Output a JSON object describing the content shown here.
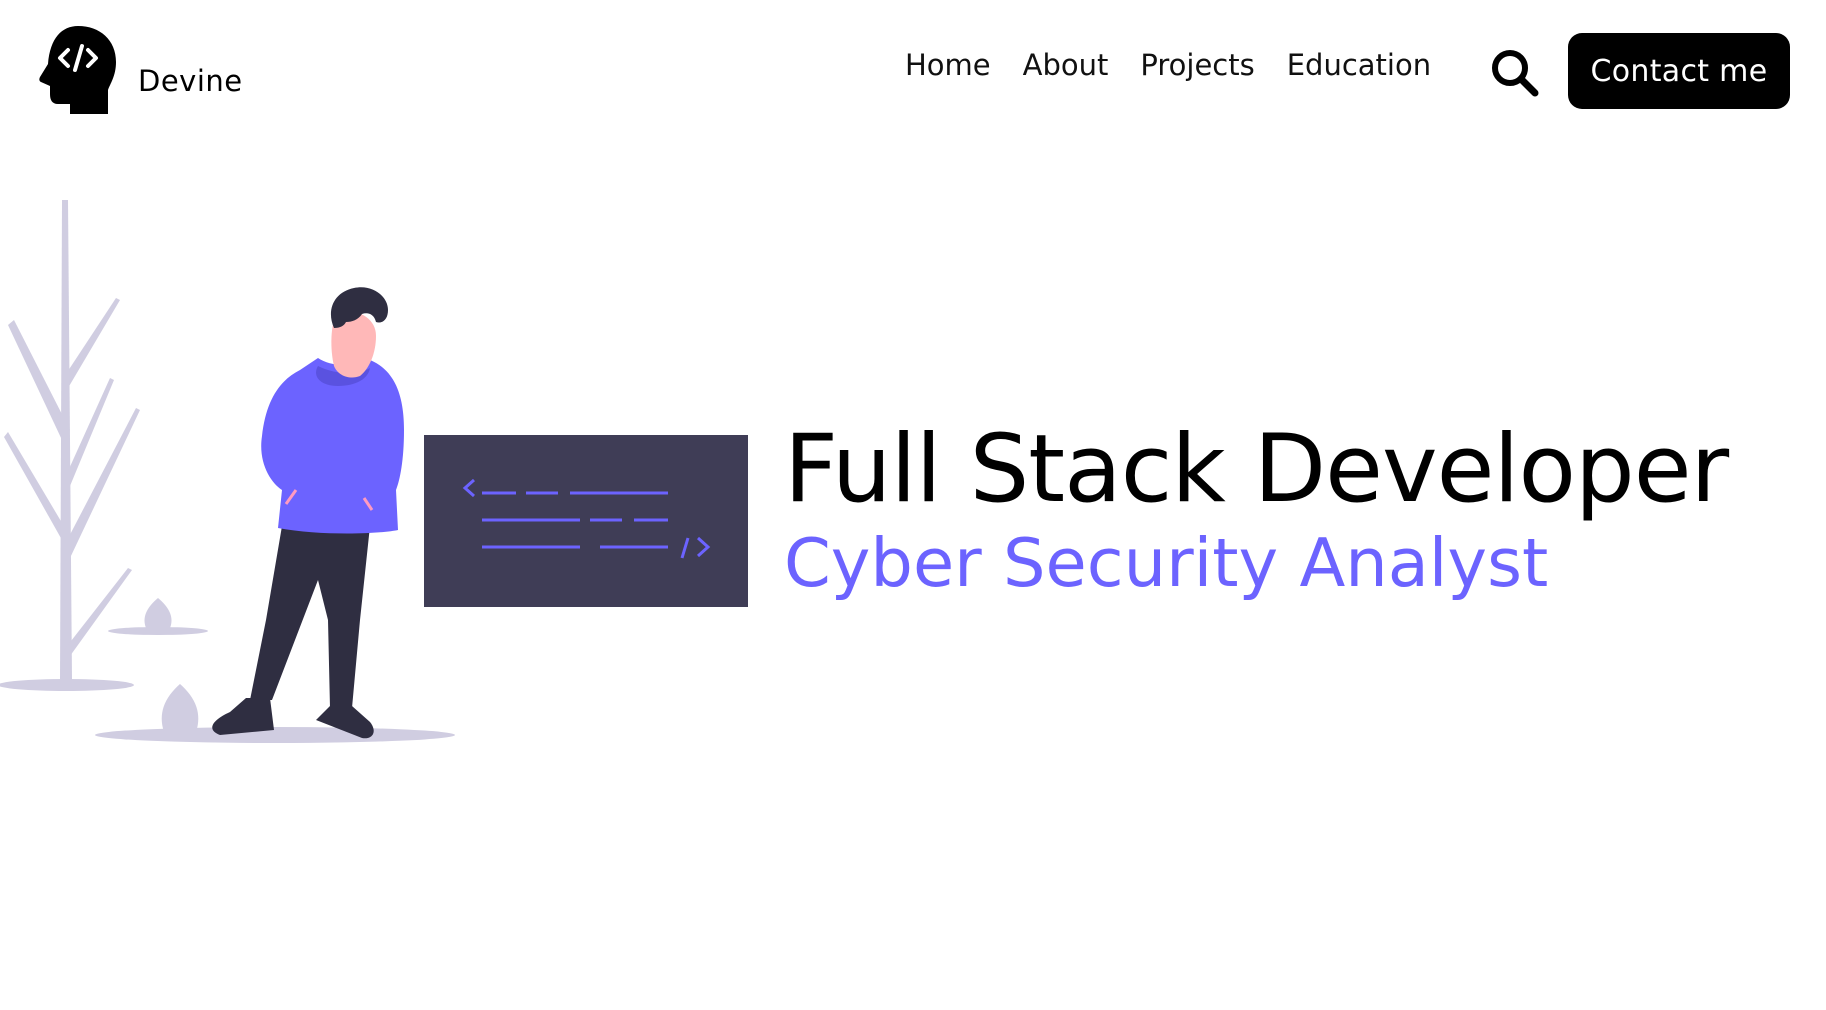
{
  "brand": {
    "name": "Devine",
    "logo_icon": "head-code-icon"
  },
  "nav": {
    "items": [
      {
        "label": "Home"
      },
      {
        "label": "About"
      },
      {
        "label": "Projects"
      },
      {
        "label": "Education"
      }
    ],
    "search_icon": "search-icon",
    "contact_label": "Contact me"
  },
  "hero": {
    "title": "Full Stack Developer",
    "subtitle": "Cyber Security Analyst",
    "illustration": "developer-with-code-screen"
  },
  "colors": {
    "accent": "#6c63ff",
    "dark_panel": "#3f3d56",
    "plant": "#d0cde1",
    "skin": "#ffb8b8",
    "text": "#000000"
  }
}
